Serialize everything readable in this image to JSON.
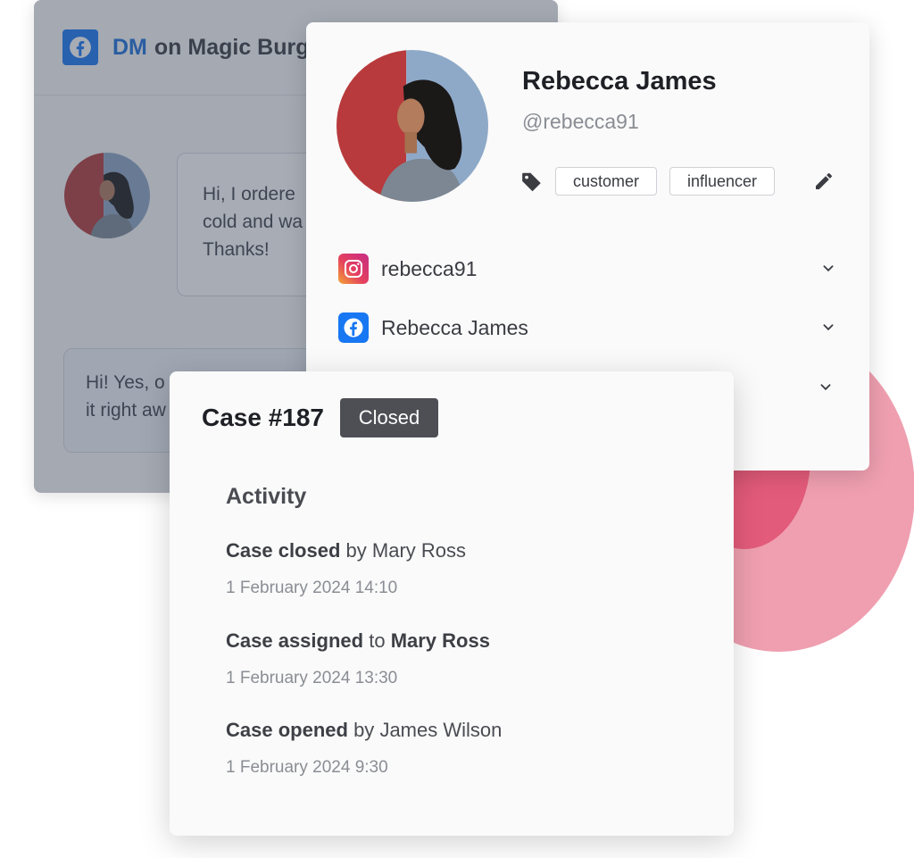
{
  "colors": {
    "facebook_blue": "#1877f2",
    "accent_pink": "#ef9fb0",
    "accent_pink_dark": "#e35b7a",
    "badge_bg": "#4d4f55"
  },
  "conversation": {
    "title_prefix": "DM",
    "title_rest": "on Magic Burg",
    "channel_icon": "facebook-icon",
    "incoming_line1": "Hi, I ordere",
    "incoming_line2": "cold and wa",
    "incoming_line3": "Thanks!",
    "reply_line1": "Hi! Yes, o",
    "reply_line2": "it right aw"
  },
  "contact": {
    "name": "Rebecca James",
    "handle": "@rebecca91",
    "tag_icon": "tag-icon",
    "tags": [
      "customer",
      "influencer"
    ],
    "edit_icon": "pencil-icon",
    "channels": [
      {
        "icon": "instagram-icon",
        "label": "rebecca91"
      },
      {
        "icon": "facebook-icon",
        "label": "Rebecca James"
      }
    ]
  },
  "case": {
    "title": "Case #187",
    "status": "Closed",
    "activity_heading": "Activity",
    "activity": [
      {
        "action": "Case closed",
        "connector": "by",
        "actor": "Mary Ross",
        "actor_bold": false,
        "timestamp": "1 February 2024 14:10"
      },
      {
        "action": "Case assigned",
        "connector": "to",
        "actor": "Mary Ross",
        "actor_bold": true,
        "timestamp": "1 February 2024 13:30"
      },
      {
        "action": "Case opened",
        "connector": "by",
        "actor": "James Wilson",
        "actor_bold": false,
        "timestamp": "1 February 2024 9:30"
      }
    ]
  }
}
